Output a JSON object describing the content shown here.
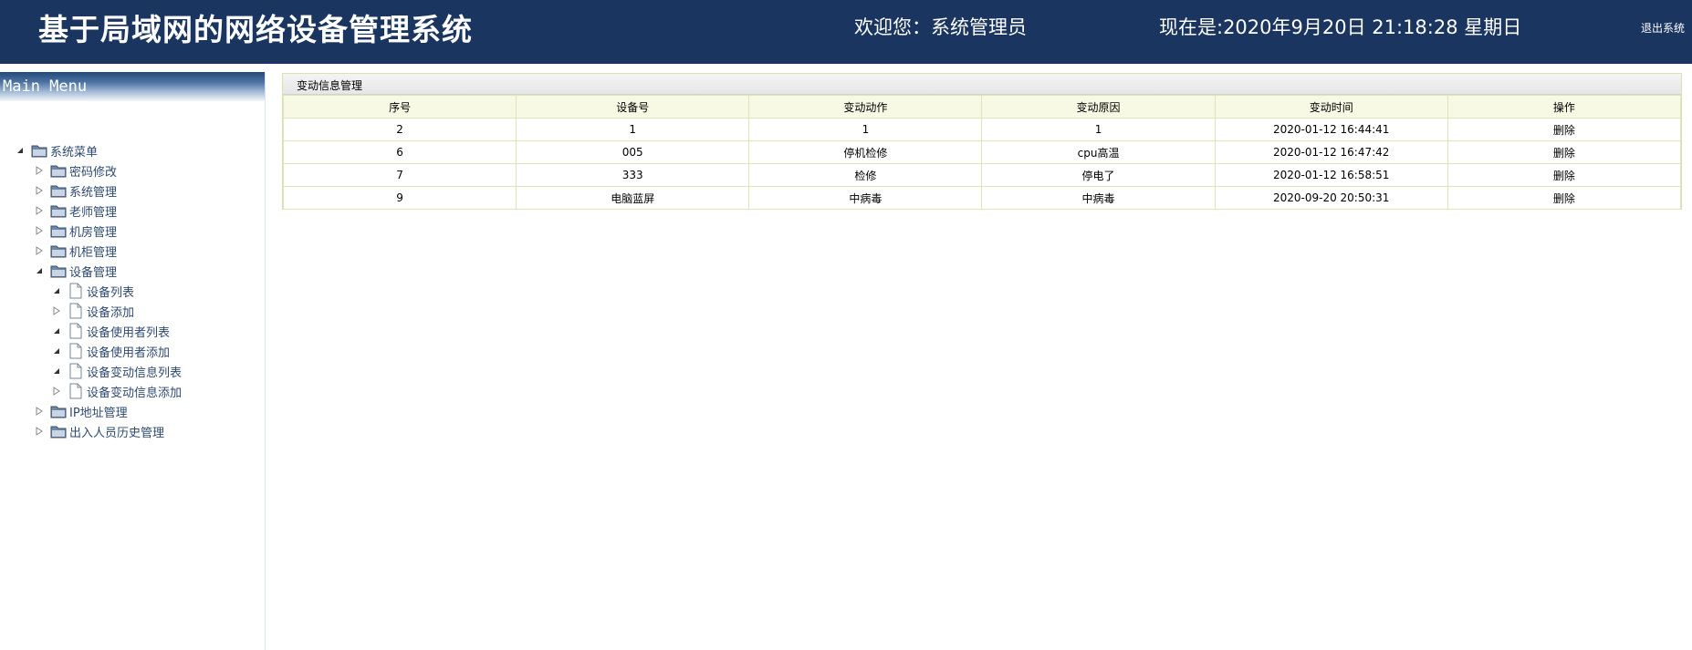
{
  "header": {
    "title": "基于局域网的网络设备管理系统",
    "welcome": "欢迎您：系统管理员",
    "clock": "现在是:2020年9月20日 21:18:28 星期日",
    "logout": "退出系统"
  },
  "sidebar": {
    "menu_title": "Main Menu",
    "root": "系统菜单",
    "items": [
      "密码修改",
      "系统管理",
      "老师管理",
      "机房管理",
      "机柜管理",
      "设备管理",
      "设备列表",
      "设备添加",
      "设备使用者列表",
      "设备使用者添加",
      "设备变动信息列表",
      "设备变动信息添加",
      "IP地址管理",
      "出入人员历史管理"
    ]
  },
  "main": {
    "panel_title": "变动信息管理",
    "columns": [
      "序号",
      "设备号",
      "变动动作",
      "变动原因",
      "变动时间",
      "操作"
    ],
    "rows": [
      [
        "2",
        "1",
        "1",
        "1",
        "2020-01-12 16:44:41",
        "删除"
      ],
      [
        "6",
        "005",
        "停机检修",
        "cpu高温",
        "2020-01-12 16:47:42",
        "删除"
      ],
      [
        "7",
        "333",
        "检修",
        "停电了",
        "2020-01-12 16:58:51",
        "删除"
      ],
      [
        "9",
        "电脑蓝屏",
        "中病毒",
        "中病毒",
        "2020-09-20 20:50:31",
        "删除"
      ]
    ]
  },
  "colors": {
    "header_bg": "#1a3560",
    "menu_text": "#2e4a72",
    "table_border": "#dce5bc",
    "table_header_bg": "#f7f9e4"
  }
}
